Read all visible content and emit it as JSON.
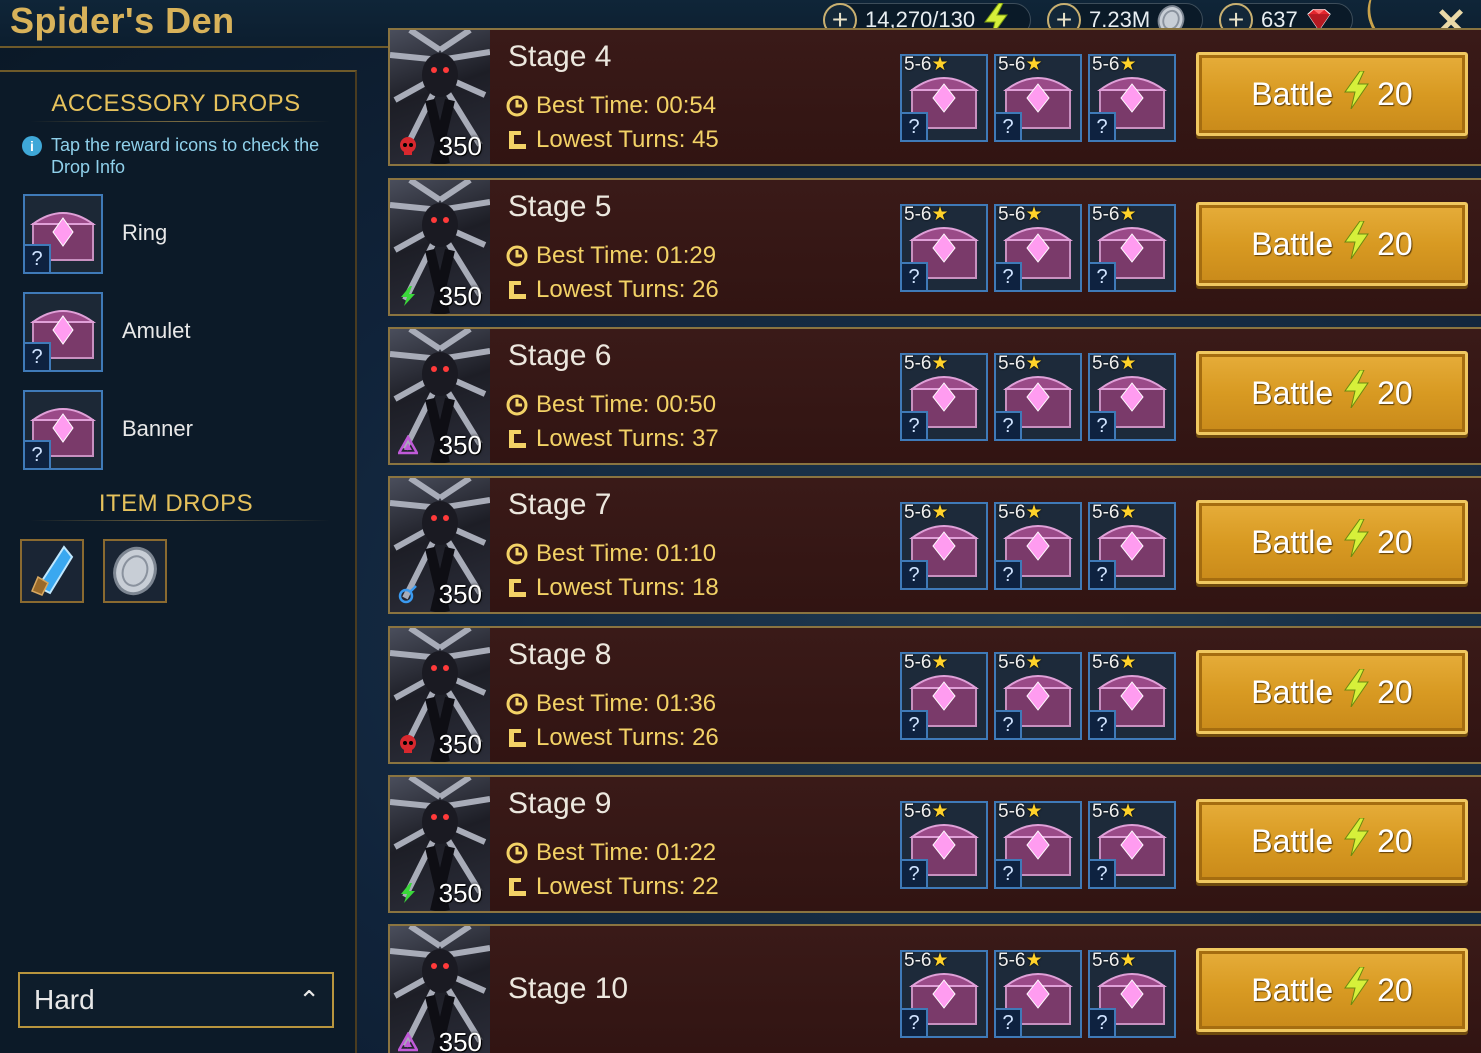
{
  "header": {
    "title": "Spider's Den",
    "resources": [
      {
        "name": "energy",
        "value": "14,270/130",
        "icon": "lightning-bolt-icon"
      },
      {
        "name": "silver",
        "value": "7.23M",
        "icon": "silver-coin-icon"
      },
      {
        "name": "gems",
        "value": "637",
        "icon": "ruby-gem-icon"
      }
    ],
    "close_icon": "close-icon"
  },
  "sidebar": {
    "accessory_title": "ACCESSORY DROPS",
    "info_text": "Tap the reward icons to check the Drop Info",
    "accessories": [
      {
        "label": "Ring",
        "badge": "?"
      },
      {
        "label": "Amulet",
        "badge": "?"
      },
      {
        "label": "Banner",
        "badge": "?"
      }
    ],
    "item_title": "ITEM DROPS",
    "items": [
      {
        "icon": "blue-crystal-shard-icon"
      },
      {
        "icon": "silver-coin-icon"
      }
    ],
    "difficulty": "Hard"
  },
  "stages": [
    {
      "name": "Stage 4",
      "best_time_label": "Best Time: 00:54",
      "lowest_turns_label": "Lowest Turns: 45",
      "level": "350",
      "affinity": "force",
      "rewards": [
        {
          "stars": "5-6",
          "badge": "?"
        },
        {
          "stars": "5-6",
          "badge": "?"
        },
        {
          "stars": "5-6",
          "badge": "?"
        }
      ],
      "battle_label": "Battle",
      "battle_cost": "20"
    },
    {
      "name": "Stage 5",
      "best_time_label": "Best Time: 01:29",
      "lowest_turns_label": "Lowest Turns: 26",
      "level": "350",
      "affinity": "spirit",
      "rewards": [
        {
          "stars": "5-6",
          "badge": "?"
        },
        {
          "stars": "5-6",
          "badge": "?"
        },
        {
          "stars": "5-6",
          "badge": "?"
        }
      ],
      "battle_label": "Battle",
      "battle_cost": "20"
    },
    {
      "name": "Stage 6",
      "best_time_label": "Best Time: 00:50",
      "lowest_turns_label": "Lowest Turns: 37",
      "level": "350",
      "affinity": "void",
      "rewards": [
        {
          "stars": "5-6",
          "badge": "?"
        },
        {
          "stars": "5-6",
          "badge": "?"
        },
        {
          "stars": "5-6",
          "badge": "?"
        }
      ],
      "battle_label": "Battle",
      "battle_cost": "20"
    },
    {
      "name": "Stage 7",
      "best_time_label": "Best Time: 01:10",
      "lowest_turns_label": "Lowest Turns: 18",
      "level": "350",
      "affinity": "magic",
      "rewards": [
        {
          "stars": "5-6",
          "badge": "?"
        },
        {
          "stars": "5-6",
          "badge": "?"
        },
        {
          "stars": "5-6",
          "badge": "?"
        }
      ],
      "battle_label": "Battle",
      "battle_cost": "20"
    },
    {
      "name": "Stage 8",
      "best_time_label": "Best Time: 01:36",
      "lowest_turns_label": "Lowest Turns: 26",
      "level": "350",
      "affinity": "force",
      "rewards": [
        {
          "stars": "5-6",
          "badge": "?"
        },
        {
          "stars": "5-6",
          "badge": "?"
        },
        {
          "stars": "5-6",
          "badge": "?"
        }
      ],
      "battle_label": "Battle",
      "battle_cost": "20"
    },
    {
      "name": "Stage 9",
      "best_time_label": "Best Time: 01:22",
      "lowest_turns_label": "Lowest Turns: 22",
      "level": "350",
      "affinity": "spirit",
      "rewards": [
        {
          "stars": "5-6",
          "badge": "?"
        },
        {
          "stars": "5-6",
          "badge": "?"
        },
        {
          "stars": "5-6",
          "badge": "?"
        }
      ],
      "battle_label": "Battle",
      "battle_cost": "20"
    },
    {
      "name": "Stage 10",
      "best_time_label": "",
      "lowest_turns_label": "",
      "level": "350",
      "affinity": "void",
      "rewards": [
        {
          "stars": "5-6",
          "badge": "?"
        },
        {
          "stars": "5-6",
          "badge": "?"
        },
        {
          "stars": "5-6",
          "badge": "?"
        }
      ],
      "battle_label": "Battle",
      "battle_cost": "20"
    }
  ],
  "colors": {
    "gold": "#e6c25c",
    "stat_yellow": "#f3d266",
    "battle_orange": "#d89a22",
    "row_bg": "#3a1a18",
    "frame_blue": "#3f7ab8"
  }
}
